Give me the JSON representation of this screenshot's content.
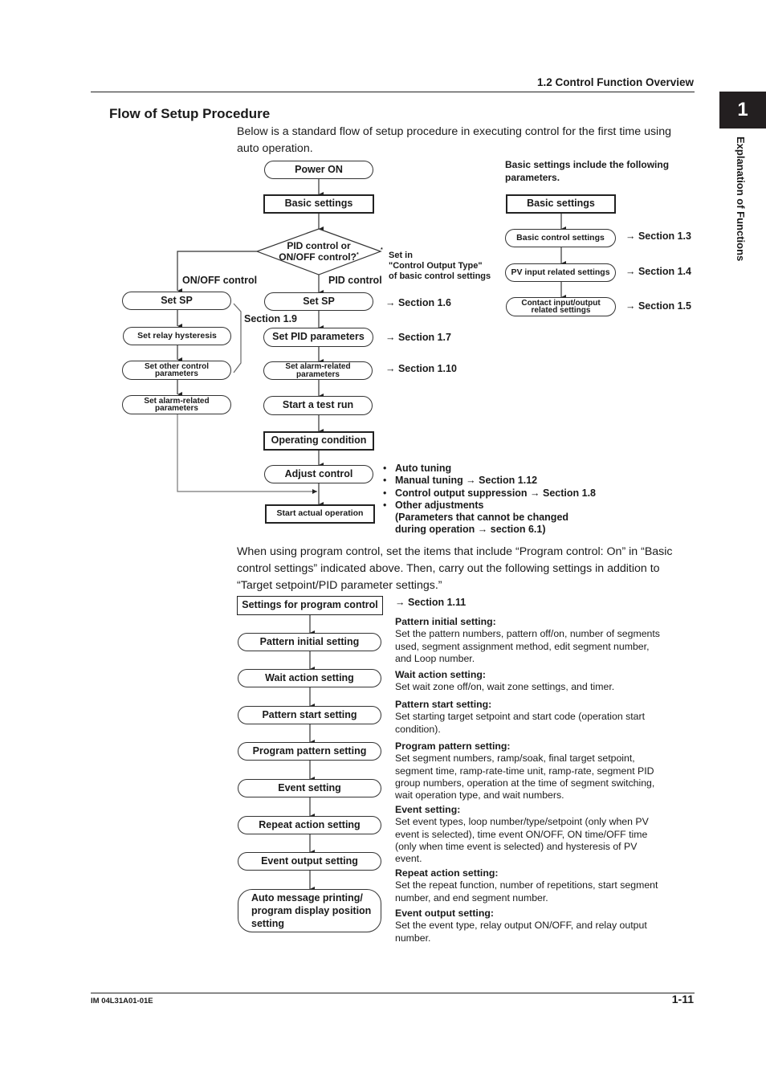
{
  "header": {
    "section_title": "1.2  Control Function Overview"
  },
  "chapter": {
    "number": "1",
    "side_label": "Explanation of Functions"
  },
  "section": {
    "title": "Flow of Setup Procedure",
    "intro": "Below is a standard flow of setup procedure in executing control for the first time using auto operation."
  },
  "main_flow": {
    "power_on": "Power ON",
    "basic_settings": "Basic settings",
    "decision": "PID control or ON/OFF control?",
    "decision_mark": "*",
    "footnote_mark": "*",
    "footnote": [
      "Set in",
      "\"Control Output Type\"",
      "of basic control settings"
    ],
    "branch_onoff": "ON/OFF control",
    "branch_pid": "PID control",
    "onoff_steps": [
      "Set SP",
      "Set relay hysteresis",
      "Set other control parameters",
      "Set alarm-related parameters"
    ],
    "onoff_ref": "Section 1.9",
    "pid_steps": [
      "Set SP",
      "Set PID parameters",
      "Set alarm-related parameters",
      "Start a test run"
    ],
    "pid_refs": [
      "→ Section 1.6",
      "→ Section 1.7",
      "→ Section 1.10"
    ],
    "operating_condition": "Operating condition",
    "adjust_control": "Adjust control",
    "start_actual": "Start actual operation",
    "adjust_items": [
      "Auto tuning",
      "Manual tuning   → Section 1.12",
      "Control output suppression → Section 1.8",
      "Other adjustments",
      "(Parameters that cannot be changed",
      "during operation → section 6.1)"
    ]
  },
  "basic_flow": {
    "caption": "Basic settings include the following parameters.",
    "title": "Basic settings",
    "steps": [
      {
        "label": "Basic control settings",
        "ref": "→ Section 1.3"
      },
      {
        "label": "PV input related settings",
        "ref": "→ Section 1.4"
      },
      {
        "label": "Contact input/output related settings",
        "ref": "→ Section 1.5"
      }
    ]
  },
  "program": {
    "intro": "When using program control, set the items that include “Program control: On” in “Basic control settings” indicated above.  Then, carry out the following settings in addition to “Target setpoint/PID parameter settings.”",
    "title": "Settings for program control",
    "ref": "→ Section 1.11",
    "steps": [
      "Pattern initial setting",
      "Wait action setting",
      "Pattern start setting",
      "Program pattern setting",
      "Event setting",
      "Repeat action setting",
      "Event output setting",
      "Auto message printing/ program display position setting"
    ],
    "descriptions": [
      {
        "title": "Pattern initial setting:",
        "text": "Set the pattern numbers, pattern off/on, number of segments used, segment assignment method, edit segment number, and Loop number."
      },
      {
        "title": "Wait action setting:",
        "text": "Set wait zone off/on, wait zone settings, and timer."
      },
      {
        "title": "Pattern start setting:",
        "text": "Set starting target setpoint and start code (operation start condition)."
      },
      {
        "title": "Program pattern setting:",
        "text": "Set segment numbers, ramp/soak, final target setpoint, segment time, ramp-rate-time unit, ramp-rate, segment PID group numbers, operation at the time of segment switching, wait operation type, and wait numbers."
      },
      {
        "title": "Event setting:",
        "text": "Set event types, loop number/type/setpoint (only when PV event is selected), time event ON/OFF, ON time/OFF time (only when time event is selected) and hysteresis of PV event."
      },
      {
        "title": "Repeat action setting:",
        "text": "Set the repeat function, number of repetitions, start segment number, and end segment number."
      },
      {
        "title": "Event output setting:",
        "text": "Set the event type, relay output ON/OFF, and relay output number."
      }
    ]
  },
  "footer": {
    "doc_id": "IM 04L31A01-01E",
    "page": "1-11"
  }
}
